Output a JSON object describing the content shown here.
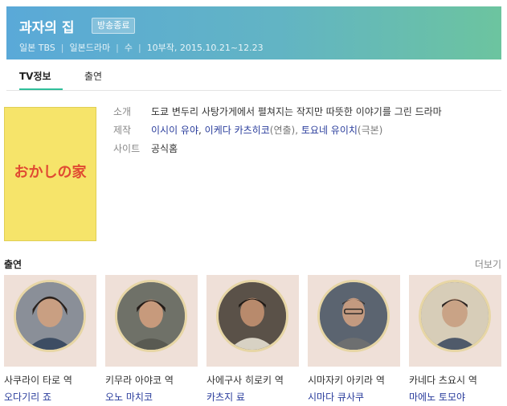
{
  "header": {
    "title": "과자의 집",
    "badge": "방송종료",
    "meta": [
      "일본 TBS",
      "일본드라마",
      "수",
      "10부작, 2015.10.21~12.23"
    ]
  },
  "tabs": [
    {
      "label": "TV정보",
      "active": true
    },
    {
      "label": "출연",
      "active": false
    }
  ],
  "poster": {
    "logo_text": "おかしの家",
    "bg_color": "#f6e46a"
  },
  "info": {
    "synopsis_label": "소개",
    "synopsis": "도쿄 변두리 사탕가게에서 펼쳐지는 작지만 따뜻한 이야기를 그린 드라마",
    "production_label": "제작",
    "production_1": "이시이 유야",
    "production_1_role": "",
    "production_2": "이케다 카츠히코",
    "production_2_role": "(연출),",
    "production_3": "토요네 유이치",
    "production_3_role": "(극본)",
    "site_label": "사이트",
    "site_link": "공식홈"
  },
  "cast_section": {
    "title": "출연",
    "more": "더보기",
    "items": [
      {
        "role": "사쿠라이 타로 역",
        "actor": "오다기리 죠"
      },
      {
        "role": "키무라 아야코 역",
        "actor": "오노 마치코"
      },
      {
        "role": "사에구사 히로키 역",
        "actor": "카츠지 료"
      },
      {
        "role": "시마자키 아키라 역",
        "actor": "시마다 큐사쿠"
      },
      {
        "role": "카네다 츠요시 역",
        "actor": "마에노 토모야"
      }
    ]
  },
  "colors": {
    "accent": "#2fbf9a",
    "link": "#2a3d9c"
  }
}
